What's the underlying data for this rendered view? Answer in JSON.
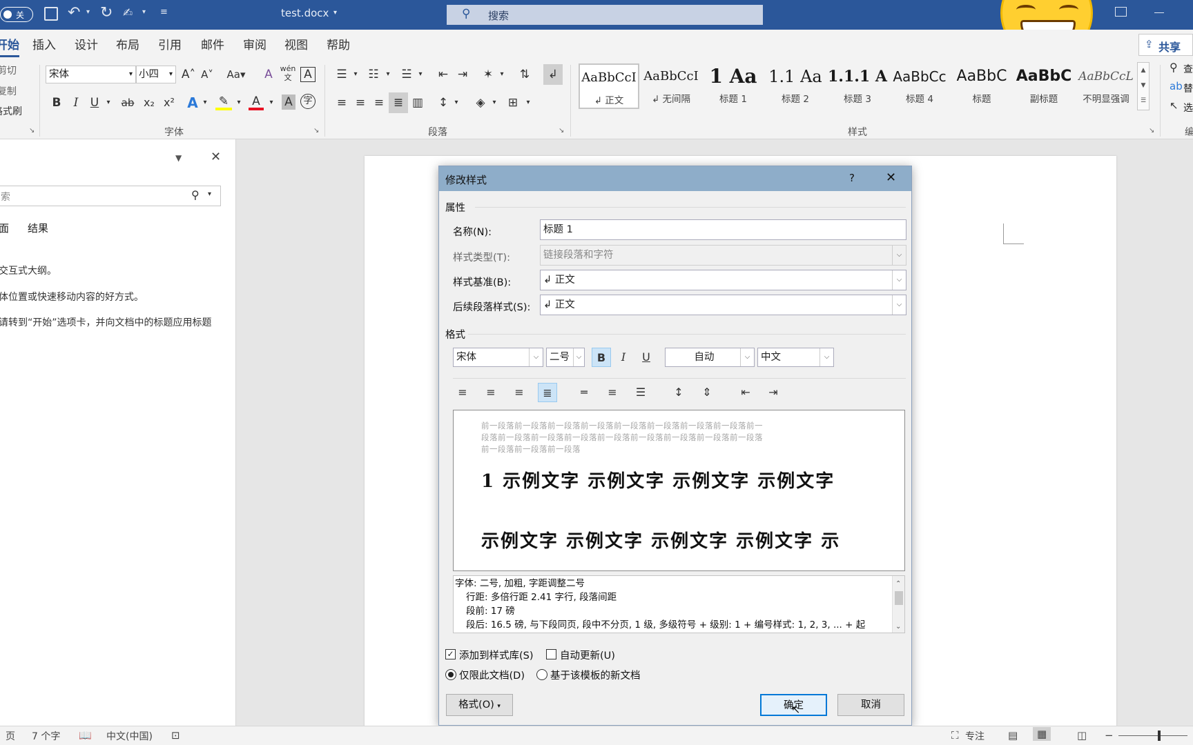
{
  "titlebar": {
    "autosave_toggle": "关",
    "filename": "test.docx",
    "search_placeholder": "搜索",
    "share_label": "共享"
  },
  "tabs": [
    "开始",
    "插入",
    "设计",
    "布局",
    "引用",
    "邮件",
    "审阅",
    "视图",
    "帮助"
  ],
  "clipboard": {
    "cut": "剪切",
    "copy": "复制",
    "format_painter": "格式刷"
  },
  "font_group": {
    "font_name": "宋体",
    "font_size": "小四",
    "label": "字体"
  },
  "paragraph_group": {
    "label": "段落"
  },
  "styles_group": {
    "label": "样式",
    "items": [
      {
        "sample": "AaBbCcI",
        "name": "↲ 正文"
      },
      {
        "sample": "AaBbCcI",
        "name": "↲ 无间隔"
      },
      {
        "sample": "1 Aa",
        "name": "标题 1"
      },
      {
        "sample": "1.1 Aa",
        "name": "标题 2"
      },
      {
        "sample": "1.1.1 A",
        "name": "标题 3"
      },
      {
        "sample": "AaBbCc",
        "name": "标题 4"
      },
      {
        "sample": "AaBbC",
        "name": "标题"
      },
      {
        "sample": "AaBbC",
        "name": "副标题"
      },
      {
        "sample": "AaBbCcL",
        "name": "不明显强调"
      }
    ]
  },
  "editing_group": {
    "find": "查",
    "replace": "替",
    "select": "选",
    "label": "编"
  },
  "nav_pane": {
    "search_placeholder": "索",
    "tab_pages": "面",
    "tab_results": "结果",
    "lines": [
      "交互式大纲。",
      "体位置或快速移动内容的好方式。",
      "请转到“开始”选项卡，并向文档中的标题应用标题"
    ]
  },
  "dialog": {
    "title": "修改样式",
    "help": "?",
    "properties_label": "属性",
    "name_label": "名称(N):",
    "name_value": "标题 1",
    "type_label": "样式类型(T):",
    "type_value": "链接段落和字符",
    "based_label": "样式基准(B):",
    "based_value": "↲ 正文",
    "next_label": "后续段落样式(S):",
    "next_value": "↲ 正文",
    "format_label": "格式",
    "font": "宋体",
    "size": "二号",
    "color": "自动",
    "script": "中文",
    "preview_prev": [
      "前一段落前一段落前一段落前一段落前一段落前一段落前一段落前一段落前一",
      "段落前一段落前一段落前一段落前一段落前一段落前一段落前一段落前一段落",
      "前一段落前一段落前一段落"
    ],
    "preview_line1": "1 示例文字  示例文字  示例文字  示例文字",
    "preview_line2": "示例文字  示例文字  示例文字  示例文字  示",
    "description": [
      "字体: 二号, 加粗, 字距调整二号",
      "行距: 多倍行距 2.41 字行, 段落间距",
      "段前: 17 磅",
      "段后: 16.5 磅, 与下段同页, 段中不分页, 1 级, 多级符号 + 级别: 1 + 编号样式: 1, 2, 3, ... + 起"
    ],
    "add_to_gallery": "添加到样式库(S)",
    "add_to_gallery_checked": true,
    "auto_update": "自动更新(U)",
    "auto_update_checked": false,
    "only_this_doc": "仅限此文档(D)",
    "new_docs_template": "基于该模板的新文档",
    "format_button": "格式(O)",
    "ok": "确定",
    "cancel": "取消"
  },
  "statusbar": {
    "page": "页",
    "word_count": "7 个字",
    "language": "中文(中国)",
    "focus": "专注"
  },
  "colors": {
    "accent": "#2b579a",
    "dialog_title": "#8eadc9",
    "highlight": "#ffff00",
    "font_color": "#e81123"
  }
}
